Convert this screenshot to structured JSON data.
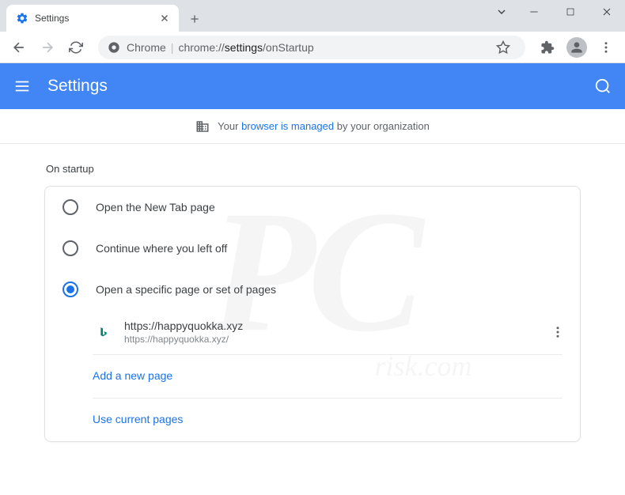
{
  "tab": {
    "title": "Settings"
  },
  "omnibox": {
    "app": "Chrome",
    "prefix": "chrome://",
    "path": "settings",
    "suffix": "/onStartup"
  },
  "header": {
    "title": "Settings"
  },
  "managed": {
    "prefix": "Your ",
    "link": "browser is managed",
    "suffix": " by your organization"
  },
  "section": {
    "title": "On startup"
  },
  "options": {
    "newTab": "Open the New Tab page",
    "continue": "Continue where you left off",
    "specific": "Open a specific page or set of pages"
  },
  "page": {
    "title": "https://happyquokka.xyz",
    "url": "https://happyquokka.xyz/"
  },
  "actions": {
    "addPage": "Add a new page",
    "useCurrent": "Use current pages"
  }
}
